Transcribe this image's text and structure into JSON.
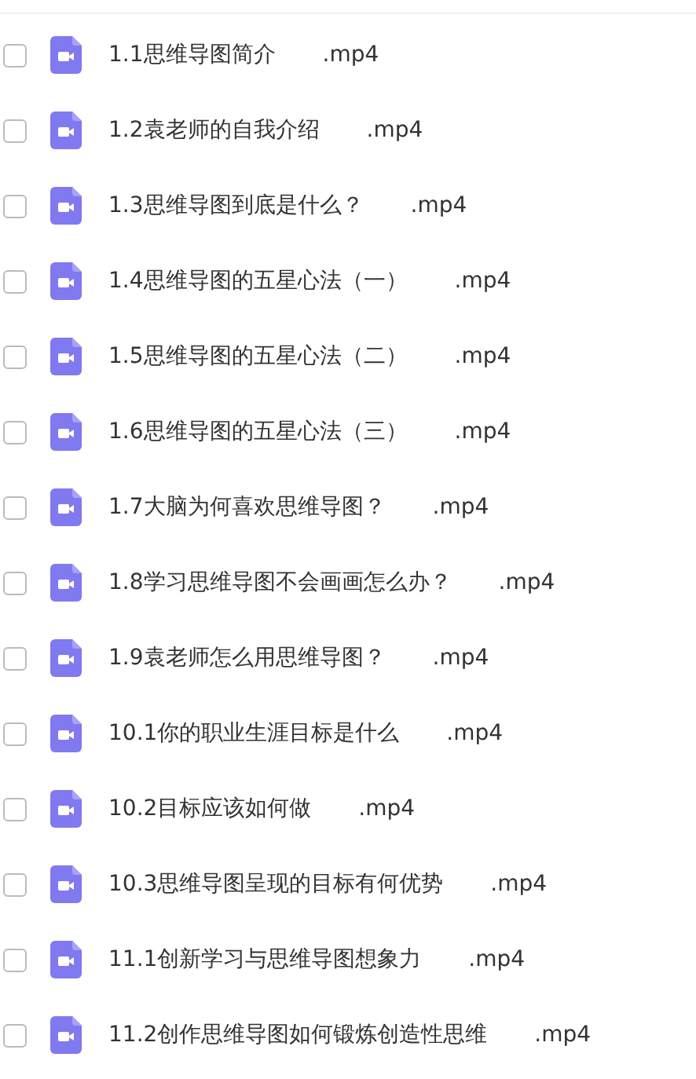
{
  "files": [
    {
      "name": "1.1思维导图简介",
      "ext": ".mp4",
      "checked": false
    },
    {
      "name": "1.2袁老师的自我介绍",
      "ext": ".mp4",
      "checked": false
    },
    {
      "name": "1.3思维导图到底是什么？",
      "ext": ".mp4",
      "checked": false
    },
    {
      "name": "1.4思维导图的五星心法（一）",
      "ext": ".mp4",
      "checked": false
    },
    {
      "name": "1.5思维导图的五星心法（二）",
      "ext": ".mp4",
      "checked": false
    },
    {
      "name": "1.6思维导图的五星心法（三）",
      "ext": ".mp4",
      "checked": false
    },
    {
      "name": "1.7大脑为何喜欢思维导图？",
      "ext": ".mp4",
      "checked": false
    },
    {
      "name": "1.8学习思维导图不会画画怎么办？",
      "ext": ".mp4",
      "checked": false
    },
    {
      "name": "1.9袁老师怎么用思维导图？",
      "ext": ".mp4",
      "checked": false
    },
    {
      "name": "10.1你的职业生涯目标是什么",
      "ext": ".mp4",
      "checked": false
    },
    {
      "name": "10.2目标应该如何做",
      "ext": ".mp4",
      "checked": false
    },
    {
      "name": "10.3思维导图呈现的目标有何优势",
      "ext": ".mp4",
      "checked": false
    },
    {
      "name": "11.1创新学习与思维导图想象力",
      "ext": ".mp4",
      "checked": false
    },
    {
      "name": "11.2创作思维导图如何锻炼创造性思维",
      "ext": ".mp4",
      "checked": false
    }
  ]
}
